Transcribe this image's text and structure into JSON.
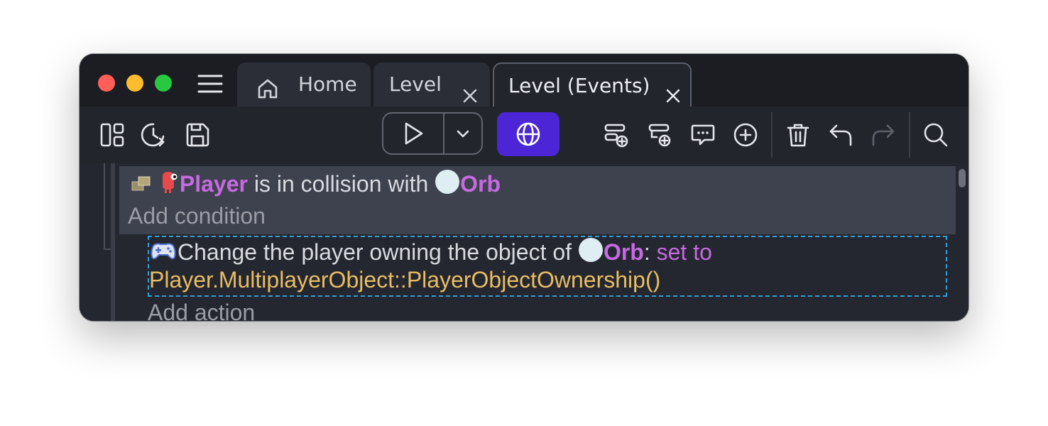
{
  "window": {
    "tabs": [
      {
        "label": "Home",
        "icon": "home-icon"
      },
      {
        "label": "Level",
        "closable": true
      },
      {
        "label": "Level (Events)",
        "closable": true,
        "active": true
      }
    ]
  },
  "toolbar": {
    "left_icons": [
      "panels-icon",
      "history-icon",
      "save-icon"
    ],
    "play_icon": "play-icon",
    "dropdown_icon": "chevron-down-icon",
    "preview_icon": "globe-icon",
    "event_icons": [
      "add-event-icon",
      "add-subevent-icon",
      "add-comment-icon",
      "add-other-icon"
    ],
    "edit_icons": [
      "delete-icon",
      "undo-icon",
      "redo-icon"
    ],
    "search_icon": "search-icon",
    "accent_color": "#4b25d6"
  },
  "event": {
    "condition": {
      "object1": "Player",
      "text": " is in collision with ",
      "object2": "Orb"
    },
    "add_condition": "Add condition",
    "action": {
      "text": "Change the player owning the object of ",
      "object": "Orb",
      "separator": ": ",
      "operator": "set to",
      "expression": "Player.MultiplayerObject::PlayerObjectOwnership()"
    },
    "add_action": "Add action"
  },
  "colors": {
    "object_name": "#c56ae0",
    "expression": "#e8bd63",
    "selection_border": "#2aa0d8"
  }
}
